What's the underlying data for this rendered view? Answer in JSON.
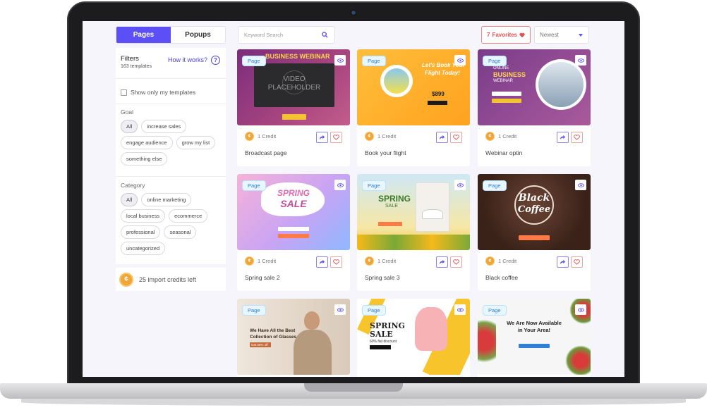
{
  "tabs": {
    "pages": "Pages",
    "popups": "Popups"
  },
  "search": {
    "placeholder": "Keyword Search"
  },
  "favorites": {
    "count": "7",
    "label": "Favorites"
  },
  "sort": {
    "selected": "Newest"
  },
  "filters": {
    "title": "Filters",
    "count": "163 templates",
    "how": "How it works?",
    "help_glyph": "?",
    "only_mine": "Show only my templates",
    "goal_label": "Goal",
    "goals": [
      "All",
      "increase sales",
      "engage audience",
      "grow my list",
      "something else"
    ],
    "category_label": "Category",
    "categories": [
      "All",
      "online marketing",
      "local business",
      "ecommerce",
      "professional",
      "seasonal",
      "uncategorized"
    ]
  },
  "credits_left": "25 import credits left",
  "badge": "Page",
  "credit_label": "1 Credit",
  "cards": [
    {
      "name": "Broadcast page",
      "t1": "BUSINESS WEBINAR",
      "t2": "VIDEO",
      "t3": "PLACEHOLDER"
    },
    {
      "name": "Book your flight",
      "t1": "Let's Book Your",
      "t2": "Flight Today!",
      "t3": "$899"
    },
    {
      "name": "Webinar optin",
      "t1": "ONLINE",
      "t2": "BUSINESS",
      "t3": "WEBINAR"
    },
    {
      "name": "Spring sale 2",
      "t1": "SPRING",
      "t2": "SALE"
    },
    {
      "name": "Spring sale 3",
      "t1": "SPRING",
      "t2": "SALE"
    },
    {
      "name": "Black coffee",
      "t1": "Black",
      "t2": "Coffee"
    },
    {
      "name": "",
      "t1": "We Have All the Best",
      "t2": "Collection of Glasses",
      "t3": "Get 55% off"
    },
    {
      "name": "",
      "t1": "SPRING",
      "t2": "SALE",
      "t3": "60% flat discount"
    },
    {
      "name": "",
      "t1": "We Are Now Available",
      "t2": "in Your Area!"
    }
  ],
  "colors": {
    "accent": "#5b4ff5",
    "favorite": "#e0524f",
    "coin": "#f0a535",
    "badge": "#2c7fd3"
  }
}
